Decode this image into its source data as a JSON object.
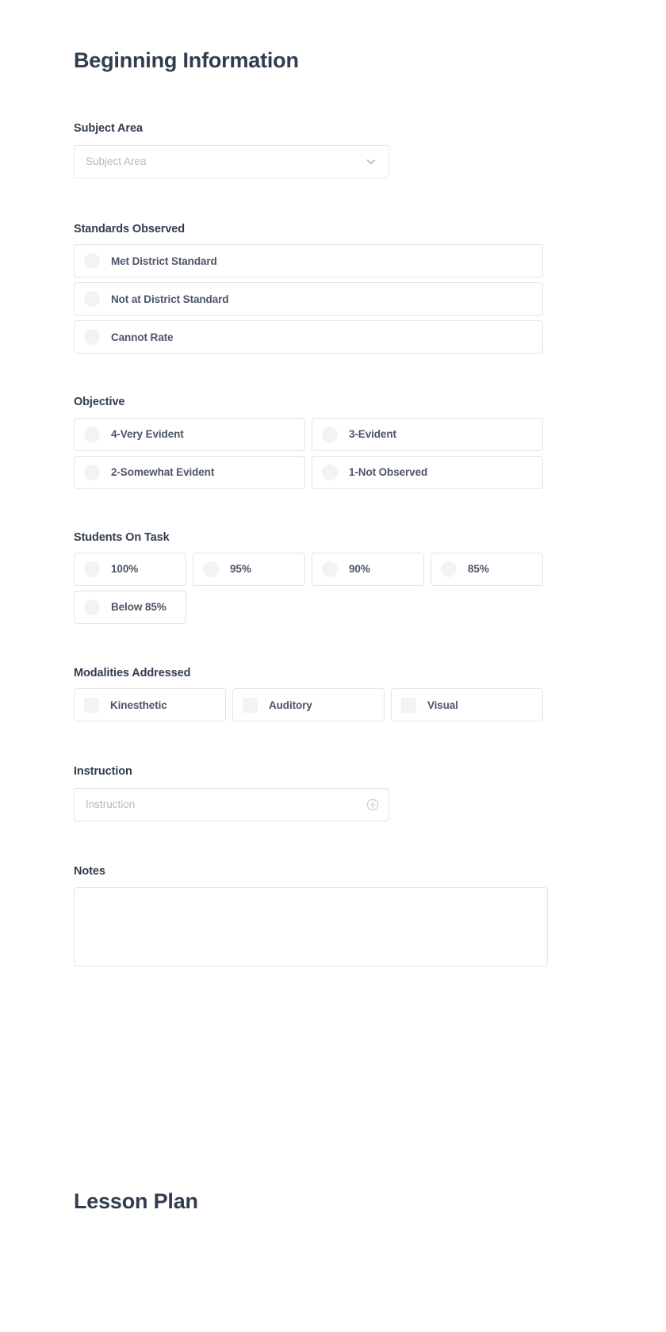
{
  "page": {
    "title": "Beginning Information",
    "footer_title": "Lesson Plan"
  },
  "colors": {
    "heading": "#313d4f",
    "label": "#4c5567",
    "placeholder": "#b4b8c0",
    "border": "#e3e4e8",
    "control_fill": "#f3f3f5",
    "background": "#ffffff"
  },
  "subject_area": {
    "label": "Subject Area",
    "placeholder": "Subject Area",
    "value": "",
    "icon": "chevron-down-icon"
  },
  "standards_observed": {
    "label": "Standards Observed",
    "type": "radio",
    "columns": 1,
    "options": [
      {
        "label": "Met District Standard",
        "selected": false
      },
      {
        "label": "Not at District Standard",
        "selected": false
      },
      {
        "label": "Cannot Rate",
        "selected": false
      }
    ]
  },
  "objective": {
    "label": "Objective",
    "type": "radio",
    "columns": 2,
    "options": [
      {
        "label": "4-Very Evident",
        "selected": false
      },
      {
        "label": "3-Evident",
        "selected": false
      },
      {
        "label": "2-Somewhat Evident",
        "selected": false
      },
      {
        "label": "1-Not Observed",
        "selected": false
      }
    ]
  },
  "students_on_task": {
    "label": "Students On Task",
    "type": "radio",
    "columns": 4,
    "options": [
      {
        "label": "100%",
        "selected": false
      },
      {
        "label": "95%",
        "selected": false
      },
      {
        "label": "90%",
        "selected": false
      },
      {
        "label": "85%",
        "selected": false
      },
      {
        "label": "Below 85%",
        "selected": false
      }
    ]
  },
  "modalities_addressed": {
    "label": "Modalities Addressed",
    "type": "checkbox",
    "columns": 3,
    "options": [
      {
        "label": "Kinesthetic",
        "checked": false
      },
      {
        "label": "Auditory",
        "checked": false
      },
      {
        "label": "Visual",
        "checked": false
      }
    ]
  },
  "instruction": {
    "label": "Instruction",
    "placeholder": "Instruction",
    "value": "",
    "icon": "plus-circle-icon"
  },
  "notes": {
    "label": "Notes",
    "placeholder": "",
    "value": ""
  }
}
